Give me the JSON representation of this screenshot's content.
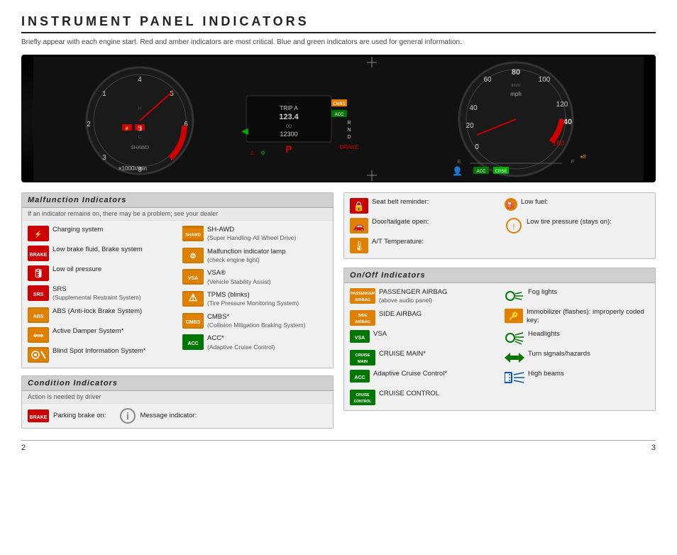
{
  "page": {
    "title": "INSTRUMENT PANEL INDICATORS",
    "subtitle": "Briefly appear with each engine start. Red and amber indicators are most critical.\nBlue and green indicators are used for general information.",
    "page_left": "2",
    "page_right": "3"
  },
  "malfunction": {
    "header": "Malfunction Indicators",
    "subtitle": "If an indicator remains on, there may be a problem; see your dealer",
    "items_left": [
      {
        "icon_type": "red",
        "icon_label": "⚡",
        "text": "Charging system",
        "sub": ""
      },
      {
        "icon_type": "red",
        "icon_label": "BRAKE",
        "text": "Low brake fluid, Brake system",
        "sub": ""
      },
      {
        "icon_type": "red",
        "icon_label": "🛢",
        "text": "Low oil pressure",
        "sub": ""
      },
      {
        "icon_type": "red",
        "icon_label": "SRS",
        "text": "SRS",
        "sub": "(Supplemental Restraint System)"
      },
      {
        "icon_type": "amber",
        "icon_label": "ABS",
        "text": "ABS (Anti-lock Brake System)",
        "sub": ""
      },
      {
        "icon_type": "amber",
        "icon_label": "⟺",
        "text": "Active Damper System*",
        "sub": ""
      },
      {
        "icon_type": "amber",
        "icon_label": "●",
        "text": "Blind Spot Information System*",
        "sub": ""
      }
    ],
    "items_right": [
      {
        "icon_type": "amber",
        "icon_label": "SHAWD",
        "text": "SH-AWD",
        "sub": "(Super Handling-All Wheel Drive)"
      },
      {
        "icon_type": "amber",
        "icon_label": "⚙",
        "text": "Malfunction indicator lamp",
        "sub": "(check engine light)"
      },
      {
        "icon_type": "amber",
        "icon_label": "VSA",
        "text": "VSA®",
        "sub": "(Vehicle Stability Assist)"
      },
      {
        "icon_type": "amber",
        "icon_label": "TPMS",
        "text": "TPMS (blinks)",
        "sub": "(Tire Pressure Monitoring System)"
      },
      {
        "icon_type": "amber",
        "icon_label": "CMBS",
        "text": "CMBS*",
        "sub": "(Collision Mitigation Braking System)"
      },
      {
        "icon_type": "green",
        "icon_label": "ACC",
        "text": "ACC*",
        "sub": "(Adaptive Cruise Control)"
      }
    ]
  },
  "condition": {
    "header": "Condition Indicators",
    "subtitle": "Action is needed by driver",
    "items": [
      {
        "icon_type": "red",
        "icon_label": "BRAKE",
        "text": "Parking brake on:"
      },
      {
        "icon_type": "amber",
        "icon_label": "ℹ",
        "text": "Message indicator:"
      }
    ]
  },
  "malfunction_right": {
    "items": [
      {
        "icon_type": "red",
        "icon_label": "🔒",
        "text": "Seat belt reminder:",
        "sub": ""
      },
      {
        "icon_type": "amber",
        "icon_label": "🚪",
        "text": "Door/tailgate open:",
        "sub": ""
      },
      {
        "icon_type": "amber",
        "icon_label": "🌡",
        "text": "A/T Temperature:",
        "sub": ""
      },
      {
        "icon_type": "amber",
        "icon_label": "⛽",
        "text": "Low fuel:",
        "sub": ""
      },
      {
        "icon_type": "amber",
        "icon_label": "TPMS",
        "text": "Low tire pressure (stays on):",
        "sub": ""
      }
    ]
  },
  "onoff": {
    "header": "On/Off Indicators",
    "items_left": [
      {
        "icon_type": "amber",
        "icon_label": "PASS\nAIRBAG",
        "text": "PASSENGER AIRBAG",
        "sub": "(above audio panel)"
      },
      {
        "icon_type": "amber",
        "icon_label": "SIDE\nAIRBAG",
        "text": "SIDE AIRBAG",
        "sub": ""
      },
      {
        "icon_type": "green",
        "icon_label": "VSA",
        "text": "VSA",
        "sub": ""
      },
      {
        "icon_type": "green",
        "icon_label": "CRUISE\nMAIN",
        "text": "CRUISE MAIN*",
        "sub": ""
      },
      {
        "icon_type": "green",
        "icon_label": "ACC",
        "text": "Adaptive Cruise Control*",
        "sub": ""
      },
      {
        "icon_type": "green",
        "icon_label": "CRUISE",
        "text": "CRUISE CONTROL",
        "sub": ""
      }
    ],
    "items_right": [
      {
        "icon_type": "green",
        "icon_label": "❄",
        "text": "Fog lights",
        "sub": ""
      },
      {
        "icon_type": "amber",
        "icon_label": "🔑",
        "text": "Immobilizer (flashes): improperly coded key:",
        "sub": ""
      },
      {
        "icon_type": "green",
        "icon_label": "💡",
        "text": "Headlights",
        "sub": ""
      },
      {
        "icon_type": "green",
        "icon_label": "↩↪",
        "text": "Turn signals/hazards",
        "sub": ""
      },
      {
        "icon_type": "blue",
        "icon_label": "≡",
        "text": "High beams",
        "sub": ""
      }
    ]
  }
}
